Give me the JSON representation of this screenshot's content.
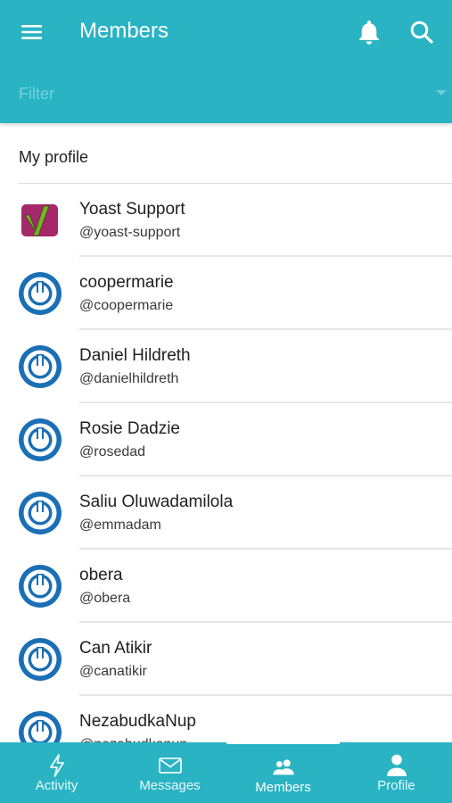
{
  "header": {
    "title": "Members",
    "menu_icon": "hamburger-icon",
    "bell_icon": "bell-icon",
    "search_icon": "search-icon",
    "background": "#2ab3c3"
  },
  "filter": {
    "placeholder": "Filter",
    "icon": "caret-down-icon"
  },
  "profile_section": {
    "label": "My profile"
  },
  "members": [
    {
      "name": "Yoast Support",
      "handle": "@yoast-support",
      "avatar": "yoast-logo"
    },
    {
      "name": "coopermarie",
      "handle": "@coopermarie",
      "avatar": "power-icon"
    },
    {
      "name": "Daniel Hildreth",
      "handle": "@danielhildreth",
      "avatar": "power-icon"
    },
    {
      "name": "Rosie Dadzie",
      "handle": "@rosedad",
      "avatar": "power-icon"
    },
    {
      "name": "Saliu Oluwadamilola",
      "handle": "@emmadam",
      "avatar": "power-icon"
    },
    {
      "name": "obera",
      "handle": "@obera",
      "avatar": "power-icon"
    },
    {
      "name": "Can Atikir",
      "handle": "@canatikir",
      "avatar": "power-icon"
    },
    {
      "name": "NezabudkaNup",
      "handle": "@nezabudkanup",
      "avatar": "power-icon"
    }
  ],
  "tabs": [
    {
      "label": "Activity",
      "icon": "lightning-icon",
      "active": false
    },
    {
      "label": "Messages",
      "icon": "envelope-icon",
      "active": false
    },
    {
      "label": "Members",
      "icon": "people-icon",
      "active": true
    },
    {
      "label": "Profile",
      "icon": "person-icon",
      "active": false
    }
  ],
  "colors": {
    "accent": "#2ab3c3",
    "avatar_blue": "#1a6fb5",
    "yoast_purple": "#a4286a",
    "yoast_green": "#77b227"
  }
}
